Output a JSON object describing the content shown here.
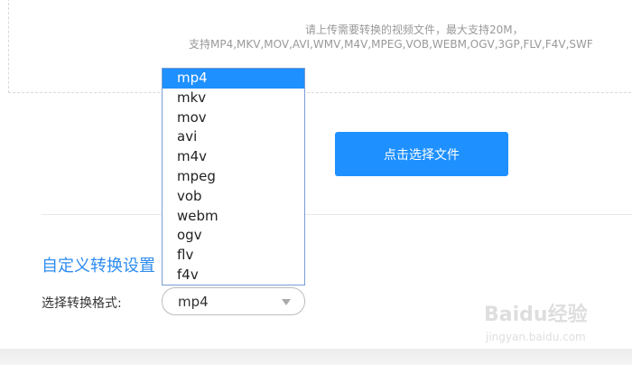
{
  "upload": {
    "hint_line1": "请上传需要转换的视频文件，最大支持20M，",
    "hint_line2": "支持MP4,MKV,MOV,AVI,WMV,M4V,MPEG,VOB,WEBM,OGV,3GP,FLV,F4V,SWF",
    "select_button_label": "点击选择文件"
  },
  "settings": {
    "section_title": "自定义转换设置",
    "format_label": "选择转换格式:",
    "format_selected": "mp4",
    "format_options": [
      "mp4",
      "mkv",
      "mov",
      "avi",
      "m4v",
      "mpeg",
      "vob",
      "webm",
      "ogv",
      "flv",
      "f4v"
    ]
  },
  "watermark": {
    "logo_text": "Baidu经验",
    "sub_text": "jingyan.baidu.com"
  },
  "colors": {
    "accent": "#1e90ff",
    "title_blue": "#2d8cf0",
    "hint_gray": "#999999"
  }
}
